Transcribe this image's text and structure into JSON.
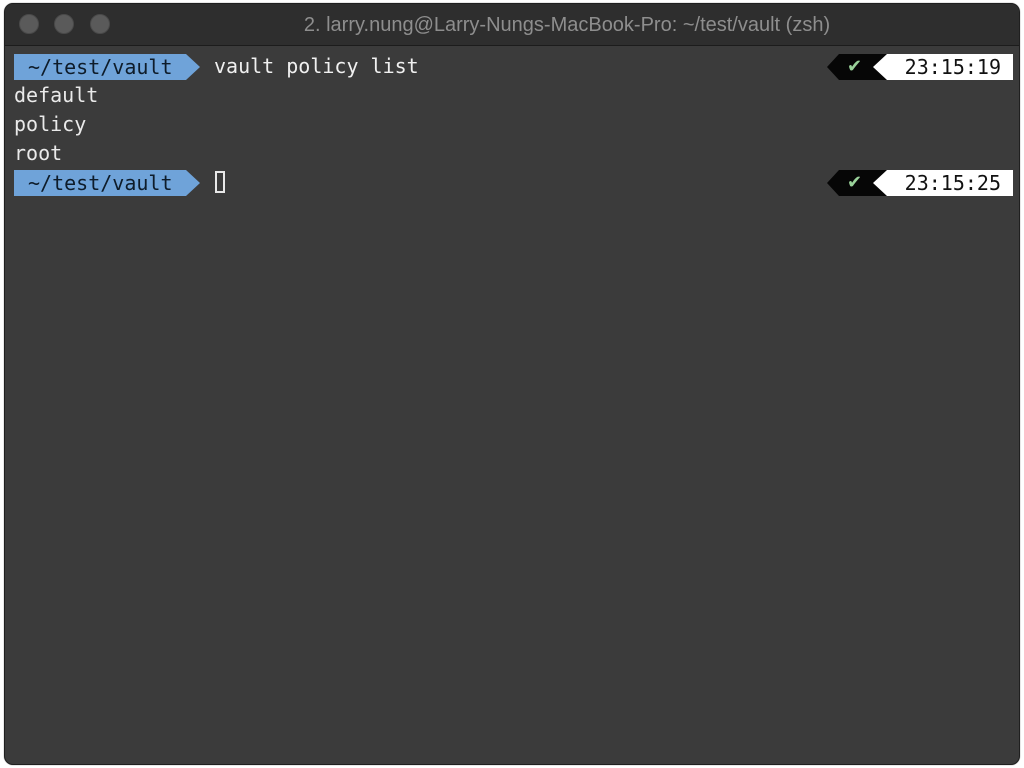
{
  "window": {
    "title": "2. larry.nung@Larry-Nungs-MacBook-Pro: ~/test/vault (zsh)"
  },
  "colors": {
    "prompt_dir_bg": "#6fa3d9",
    "status_ok_bg": "#060606",
    "check_color": "#9ad29a",
    "time_bg": "#ffffff",
    "terminal_bg": "#3b3b3b"
  },
  "terminal": {
    "prompt1": {
      "dir": "~/test/vault",
      "command": "vault policy list",
      "status_icon": "✔",
      "time": "23:15:19"
    },
    "output": [
      "default",
      "policy",
      "root"
    ],
    "prompt2": {
      "dir": "~/test/vault",
      "status_icon": "✔",
      "time": "23:15:25"
    }
  }
}
